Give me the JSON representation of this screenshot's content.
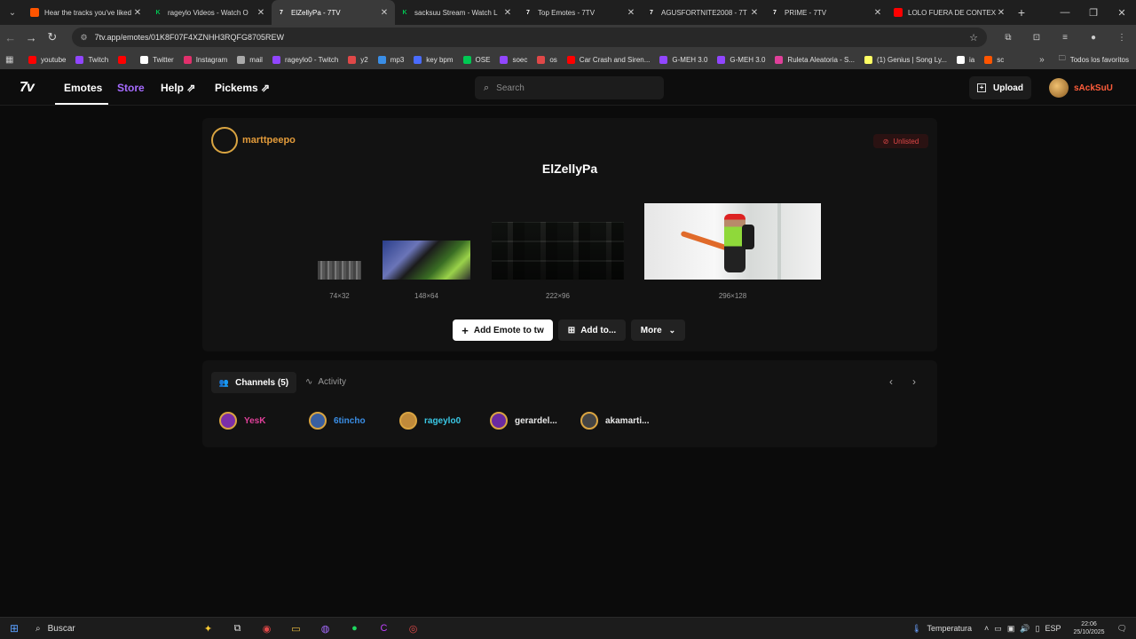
{
  "browser": {
    "tabs": [
      {
        "title": "Hear the tracks you've liked",
        "color": "#ff5500",
        "glyph": "",
        "active": false
      },
      {
        "title": "rageylo Videos - Watch O",
        "color": "#00c853",
        "glyph": "K",
        "active": false
      },
      {
        "title": "ElZellyPa - 7TV",
        "color": "#ffffff",
        "glyph": "7",
        "active": true
      },
      {
        "title": "sacksuu Stream - Watch L",
        "color": "#00c853",
        "glyph": "K",
        "active": false
      },
      {
        "title": "Top Emotes - 7TV",
        "color": "#ffffff",
        "glyph": "7",
        "active": false
      },
      {
        "title": "AGUSFORTNITE2008 - 7T",
        "color": "#ffffff",
        "glyph": "7",
        "active": false
      },
      {
        "title": "PRIME - 7TV",
        "color": "#ffffff",
        "glyph": "7",
        "active": false
      },
      {
        "title": "LOLO FUERA DE CONTEX",
        "color": "#ff0000",
        "glyph": "",
        "active": false
      }
    ],
    "url": "7tv.app/emotes/01K8F07F4XZNHH3RQFG8705REW",
    "bookmarks": [
      {
        "label": "youtube",
        "color": "#ff0000"
      },
      {
        "label": "Twitch",
        "color": "#9146ff"
      },
      {
        "label": "",
        "color": "#ff0000"
      },
      {
        "label": "Twitter",
        "color": "#ffffff"
      },
      {
        "label": "Instagram",
        "color": "#e1306c"
      },
      {
        "label": "mail",
        "color": "#aaaaaa"
      },
      {
        "label": "rageylo0 - Twitch",
        "color": "#9146ff"
      },
      {
        "label": "y2",
        "color": "#e04848"
      },
      {
        "label": "mp3",
        "color": "#3a8ee6"
      },
      {
        "label": "key bpm",
        "color": "#4a6cff"
      },
      {
        "label": "OSE",
        "color": "#00c853"
      },
      {
        "label": "soec",
        "color": "#9146ff"
      },
      {
        "label": "os",
        "color": "#e04848"
      },
      {
        "label": "Car Crash and Siren...",
        "color": "#ff0000"
      },
      {
        "label": "G-MEH 3.0",
        "color": "#9146ff"
      },
      {
        "label": "G-MEH 3.0",
        "color": "#9146ff"
      },
      {
        "label": "Ruleta Aleatoria - S...",
        "color": "#e0409a"
      },
      {
        "label": "(1) Genius | Song Ly...",
        "color": "#ffff64"
      },
      {
        "label": "ia",
        "color": "#ffffff"
      },
      {
        "label": "sc",
        "color": "#ff5500"
      }
    ],
    "bookmarks_folder": "Todos los favoritos"
  },
  "site": {
    "logo": "7v",
    "nav": {
      "emotes": "Emotes",
      "store": "Store",
      "help": "Help",
      "pickems": "Pickems"
    },
    "search_placeholder": "Search",
    "upload": "Upload",
    "username": "sAckSuU"
  },
  "emote": {
    "owner": "marttpeepo",
    "status": "Unlisted",
    "name": "ElZellyPa",
    "sizes": [
      "74×32",
      "148×64",
      "222×96",
      "296×128"
    ],
    "actions": {
      "add": "Add Emote to tw",
      "add_to": "Add to...",
      "more": "More"
    }
  },
  "channels": {
    "tab_channels": "Channels (5)",
    "tab_activity": "Activity",
    "list": [
      {
        "name": "YesK",
        "color": "#e0409a"
      },
      {
        "name": "6tincho",
        "color": "#3a8ee6"
      },
      {
        "name": "rageylo0",
        "color": "#3ac8e6"
      },
      {
        "name": "gerardel...",
        "color": "#e8e8e8"
      },
      {
        "name": "akamarti...",
        "color": "#e8e8e8"
      }
    ]
  },
  "taskbar": {
    "search": "Buscar",
    "weather": "Temperatura",
    "lang": "ESP",
    "time": "22:06",
    "date": "25/10/2025"
  }
}
